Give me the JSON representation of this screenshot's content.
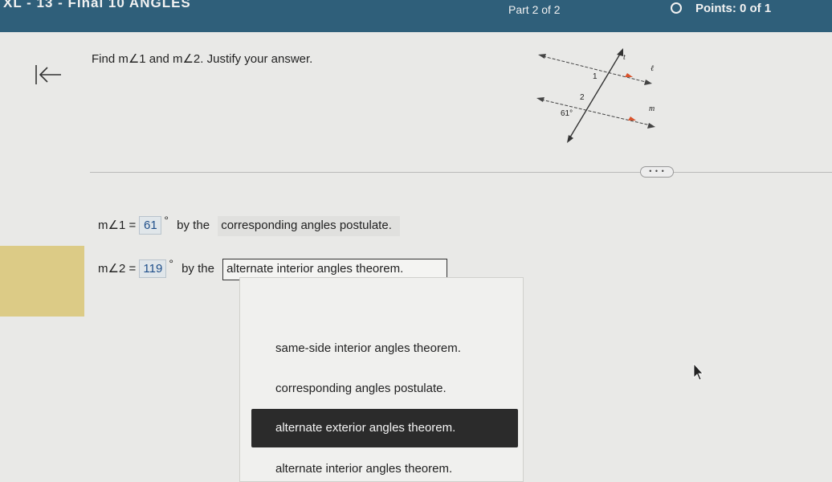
{
  "header": {
    "title": "XL - 13 - Final 10 ANGLES",
    "part": "Part 2 of 2",
    "points": "Points: 0 of 1"
  },
  "question": {
    "text": "Find m∠1 and m∠2. Justify your answer."
  },
  "figure": {
    "line_t": "t",
    "line_l": "ℓ",
    "line_m": "m",
    "angle_1": "1",
    "angle_2": "2",
    "given_angle": "61°",
    "arrow_color": "#d9532c"
  },
  "divider": {
    "more_label": "• • •"
  },
  "answers": {
    "row1": {
      "label": "m∠1 =",
      "value": "61",
      "degree": "°",
      "by_text": "by the",
      "justification": "corresponding angles postulate."
    },
    "row2": {
      "label": "m∠2 =",
      "value": "119",
      "degree": "°",
      "by_text": "by the",
      "justification": "alternate interior angles theorem."
    }
  },
  "dropdown": {
    "options": [
      "",
      "same-side interior angles theorem.",
      "corresponding angles postulate.",
      "alternate exterior angles theorem.",
      "alternate interior angles theorem."
    ],
    "highlighted": "alternate exterior angles theorem."
  }
}
